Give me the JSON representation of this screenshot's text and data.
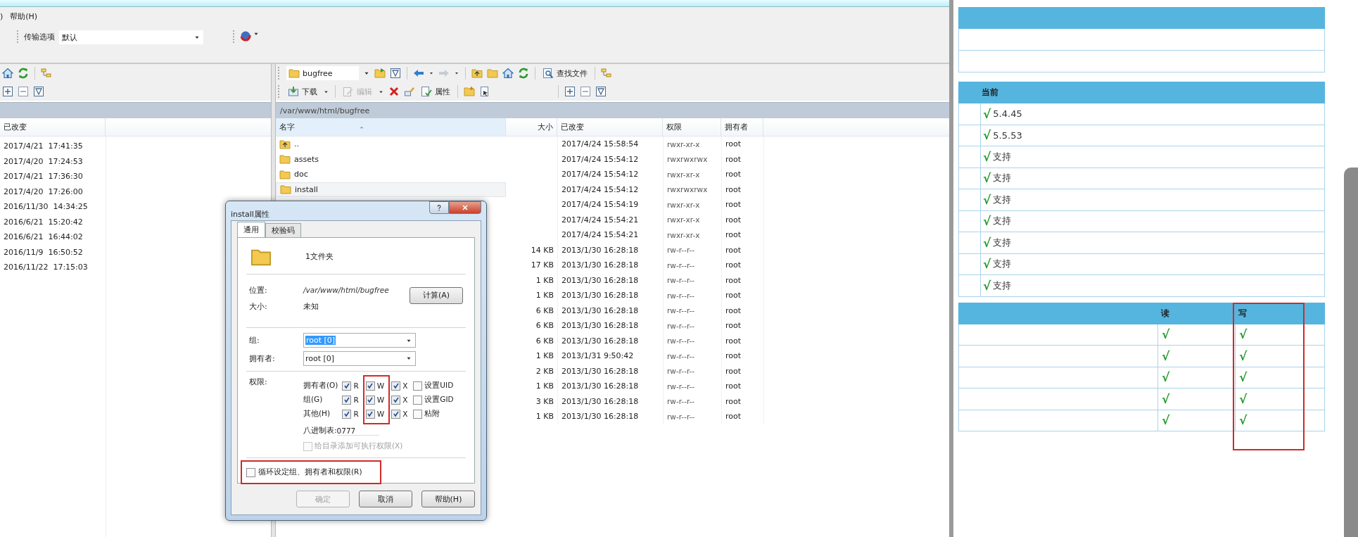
{
  "menu": [
    {
      "label": ")"
    },
    {
      "label": "帮助(H)"
    }
  ],
  "transfer": {
    "label": "传输选项",
    "value": "默认"
  },
  "left_pane": {
    "columns": [
      "已改变"
    ],
    "rows": [
      "2017/4/21  17:41:35",
      "2017/4/20  17:24:53",
      "2017/4/21  17:36:30",
      "2017/4/20  17:26:00",
      "2016/11/30  14:34:25",
      "2016/6/21  15:20:42",
      "2016/6/21  16:44:02",
      "2016/11/9  16:50:52",
      "2016/11/22  17:15:03"
    ]
  },
  "right_pane": {
    "folder": "bugfree",
    "search_button": "查找文件",
    "actions": [
      {
        "label": "下载",
        "disabled": false
      },
      {
        "label": "编辑",
        "disabled": true
      },
      {
        "label": "属性",
        "disabled": false
      }
    ],
    "path": "/var/www/html/bugfree",
    "columns": [
      "名字",
      "大小",
      "已改变",
      "权限",
      "拥有者"
    ],
    "rows": [
      {
        "kind": "up",
        "name": "..",
        "changed": "2017/4/24 15:58:54",
        "perms": "rwxr-xr-x",
        "owner": "root",
        "selected": false
      },
      {
        "kind": "folder",
        "name": "assets",
        "changed": "2017/4/24 15:54:12",
        "perms": "rwxrwxrwx",
        "owner": "root",
        "selected": false
      },
      {
        "kind": "folder",
        "name": "doc",
        "changed": "2017/4/24 15:54:12",
        "perms": "rwxr-xr-x",
        "owner": "root",
        "selected": false
      },
      {
        "kind": "folder",
        "name": "install",
        "changed": "2017/4/24 15:54:12",
        "perms": "rwxrwxrwx",
        "owner": "root",
        "selected": true
      },
      {
        "changed": "2017/4/24 15:54:19",
        "perms": "rwxr-xr-x",
        "owner": "root",
        "selected": false
      },
      {
        "changed": "2017/4/24 15:54:21",
        "perms": "rwxr-xr-x",
        "owner": "root",
        "selected": false
      },
      {
        "changed": "2017/4/24 15:54:21",
        "perms": "rwxr-xr-x",
        "owner": "root",
        "selected": false
      },
      {
        "size": "14 KB",
        "changed": "2013/1/30 16:28:18",
        "perms": "rw-r--r--",
        "owner": "root",
        "selected": false
      },
      {
        "size": "17 KB",
        "changed": "2013/1/30 16:28:18",
        "perms": "rw-r--r--",
        "owner": "root",
        "selected": false
      },
      {
        "size": "1 KB",
        "changed": "2013/1/30 16:28:18",
        "perms": "rw-r--r--",
        "owner": "root",
        "selected": false
      },
      {
        "size": "1 KB",
        "changed": "2013/1/30 16:28:18",
        "perms": "rw-r--r--",
        "owner": "root",
        "selected": false
      },
      {
        "size": "6 KB",
        "changed": "2013/1/30 16:28:18",
        "perms": "rw-r--r--",
        "owner": "root",
        "selected": false
      },
      {
        "size": "6 KB",
        "changed": "2013/1/30 16:28:18",
        "perms": "rw-r--r--",
        "owner": "root",
        "selected": false
      },
      {
        "size": "6 KB",
        "changed": "2013/1/30 16:28:18",
        "perms": "rw-r--r--",
        "owner": "root",
        "selected": false
      },
      {
        "size": "1 KB",
        "changed": "2013/1/31 9:50:42",
        "perms": "rw-r--r--",
        "owner": "root",
        "selected": false
      },
      {
        "size": "2 KB",
        "changed": "2013/1/30 16:28:18",
        "perms": "rw-r--r--",
        "owner": "root",
        "selected": false
      },
      {
        "size": "1 KB",
        "changed": "2013/1/30 16:28:18",
        "perms": "rw-r--r--",
        "owner": "root",
        "selected": false
      },
      {
        "size": "3 KB",
        "changed": "2013/1/30 16:28:18",
        "perms": "rw-r--r--",
        "owner": "root",
        "selected": false
      },
      {
        "size": "1 KB",
        "changed": "2013/1/30 16:28:18",
        "perms": "rw-r--r--",
        "owner": "root",
        "selected": false
      }
    ]
  },
  "dialog": {
    "title": "install属性",
    "tabs": [
      {
        "label": "通用",
        "selected": true
      },
      {
        "label": "校验码",
        "selected": false
      }
    ],
    "type_text": "1文件夹",
    "fields": [
      {
        "label": "位置:",
        "value": "/var/www/html/bugfree"
      },
      {
        "label": "大小:",
        "value": "未知"
      }
    ],
    "calc_button": "计算(A)",
    "selects": [
      {
        "label": "组:",
        "value": "root [0]",
        "highlighted": true
      },
      {
        "label": "拥有者:",
        "value": "root [0]",
        "highlighted": false
      }
    ],
    "permissions": {
      "label": "权限:",
      "columns": [
        {
          "highlighted": false
        },
        {
          "highlighted": true
        },
        {
          "highlighted": false
        }
      ],
      "rows": [
        {
          "label": "拥有者(O)",
          "checks": [
            {
              "label": "R",
              "checked": true
            },
            {
              "label": "W",
              "checked": true
            },
            {
              "label": "X",
              "checked": true
            }
          ],
          "extra": {
            "label": "设置UID",
            "checked": false
          }
        },
        {
          "label": "组(G)",
          "checks": [
            {
              "label": "R",
              "checked": true
            },
            {
              "label": "W",
              "checked": true
            },
            {
              "label": "X",
              "checked": true
            }
          ],
          "extra": {
            "label": "设置GID",
            "checked": false
          }
        },
        {
          "label": "其他(H)",
          "checks": [
            {
              "label": "R",
              "checked": true
            },
            {
              "label": "W",
              "checked": true
            },
            {
              "label": "X",
              "checked": true
            }
          ],
          "extra": {
            "label": "粘附",
            "checked": false
          }
        }
      ]
    },
    "octal": {
      "label": "八进制表:",
      "value": "0777"
    },
    "exec_option": {
      "label": "给目录添加可执行权限(X)",
      "checked": false,
      "disabled": true
    },
    "recursive": {
      "label": "循环设定组、拥有者和权限(R)",
      "checked": false,
      "highlighted": true
    },
    "buttons": [
      {
        "label": "确定",
        "disabled": true
      },
      {
        "label": "取消",
        "disabled": false
      },
      {
        "label": "帮助(H)",
        "disabled": false
      }
    ]
  },
  "web": {
    "version_table": {
      "header": "当前",
      "rows": [
        {
          "mark": "√",
          "value": "5.4.45"
        },
        {
          "mark": "√",
          "value": "5.5.53"
        },
        {
          "mark": "√",
          "value": "支持"
        },
        {
          "mark": "√",
          "value": "支持"
        },
        {
          "mark": "√",
          "value": "支持"
        },
        {
          "mark": "√",
          "value": "支持"
        },
        {
          "mark": "√",
          "value": "支持"
        },
        {
          "mark": "√",
          "value": "支持"
        },
        {
          "mark": "√",
          "value": "支持"
        }
      ]
    },
    "perm_table": {
      "columns": [
        {
          "label": "读"
        },
        {
          "label": "写",
          "highlighted": true
        }
      ],
      "rows": [
        [
          "√",
          "√"
        ],
        [
          "√",
          "√"
        ],
        [
          "√",
          "√"
        ],
        [
          "√",
          "√"
        ],
        [
          "√",
          "√"
        ]
      ]
    }
  }
}
